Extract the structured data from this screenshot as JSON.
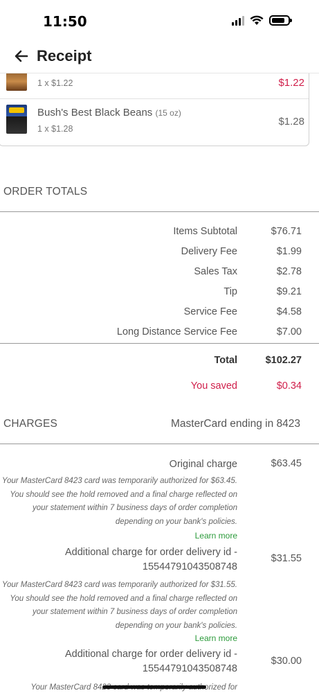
{
  "status_bar": {
    "time": "11:50"
  },
  "header": {
    "title": "Receipt"
  },
  "items": [
    {
      "name": "",
      "size": "",
      "qty_price": "1 x $1.22",
      "total": "$1.22"
    },
    {
      "name": "Bush's Best Black Beans",
      "size": "(15 oz)",
      "qty_price": "1 x $1.28",
      "total": "$1.28"
    }
  ],
  "order_totals": {
    "title": "ORDER TOTALS",
    "lines": [
      {
        "label": "Items Subtotal",
        "value": "$76.71"
      },
      {
        "label": "Delivery Fee",
        "value": "$1.99"
      },
      {
        "label": "Sales Tax",
        "value": "$2.78"
      },
      {
        "label": "Tip",
        "value": "$9.21"
      },
      {
        "label": "Service Fee",
        "value": "$4.58"
      },
      {
        "label": "Long Distance Service Fee",
        "value": "$7.00"
      }
    ],
    "total_label": "Total",
    "total_value": "$102.27",
    "saved_label": "You saved",
    "saved_value": "$0.34"
  },
  "charges": {
    "title": "CHARGES",
    "card": "MasterCard ending in 8423",
    "entries": [
      {
        "label": "Original charge",
        "value": "$63.45",
        "note": "Your MasterCard 8423 card was temporarily authorized for $63.45. You should see the hold removed and a final charge reflected on your statement within 7 business days of order completion depending on your bank's policies.",
        "link": "Learn more"
      },
      {
        "label": "Additional charge for order delivery id - 15544791043508748",
        "value": "$31.55",
        "note": "Your MasterCard 8423 card was temporarily authorized for $31.55. You should see the hold removed and a final charge reflected on your statement within 7 business days of order completion depending on your bank's policies.",
        "link": "Learn more"
      },
      {
        "label": "Additional charge for order delivery id - 15544791043508748",
        "value": "$30.00",
        "note": "Your MasterCard 8423 card was temporarily authorized for",
        "link": ""
      }
    ]
  },
  "colors": {
    "accent_red": "#d01e4a",
    "link_green": "#2b9a3a"
  }
}
